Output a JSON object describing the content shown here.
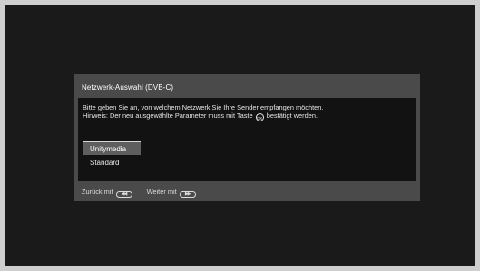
{
  "dialog": {
    "title": "Netzwerk-Auswahl (DVB-C)",
    "instruction_line1": "Bitte geben Sie an, von welchem Netzwerk Sie Ihre Sender empfangen möchten.",
    "instruction_line2_pre": "Hinweis: Der neu ausgewählte Parameter muss mit Taste",
    "ok_key": "OK",
    "instruction_line2_post": "bestätigt werden.",
    "options": [
      {
        "label": "Unitymedia",
        "selected": true
      },
      {
        "label": "Standard",
        "selected": false
      }
    ]
  },
  "footer": {
    "back_label": "Zurück mit",
    "back_key": "◀◀",
    "next_label": "Weiter mit",
    "next_key": "▶▶"
  }
}
